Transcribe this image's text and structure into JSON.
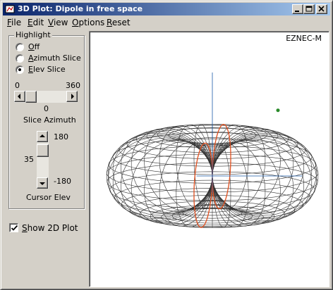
{
  "window": {
    "title": "3D Plot: Dipole in free space",
    "minimize_icon": "minimize-icon",
    "maximize_icon": "maximize-icon",
    "close_icon": "close-icon"
  },
  "menu": {
    "items": [
      {
        "prefix": "",
        "key": "F",
        "rest": "ile"
      },
      {
        "prefix": "",
        "key": "E",
        "rest": "dit"
      },
      {
        "prefix": "",
        "key": "V",
        "rest": "iew"
      },
      {
        "prefix": "",
        "key": "O",
        "rest": "ptions"
      },
      {
        "prefix": "",
        "key": "R",
        "rest": "eset"
      }
    ]
  },
  "highlight": {
    "title": "Highlight",
    "options": [
      {
        "prefix": "",
        "key": "O",
        "rest": "ff",
        "selected": false
      },
      {
        "prefix": "",
        "key": "A",
        "rest": "zimuth Slice",
        "selected": false
      },
      {
        "prefix": "",
        "key": "E",
        "rest": "lev Slice",
        "selected": true
      }
    ]
  },
  "slice_azimuth": {
    "min_label": "0",
    "max_label": "360",
    "value": "0",
    "label": "Slice Azimuth"
  },
  "cursor_elev": {
    "max_label": "180",
    "min_label": "-180",
    "value": "35",
    "label": "Cursor Elev"
  },
  "show_2d": {
    "prefix": "",
    "key": "S",
    "rest": "how 2D Plot",
    "checked": true
  },
  "plot": {
    "label": "EZNEC-M",
    "pattern": "dipole-3d-pattern",
    "colors": {
      "mesh": "#333333",
      "slice": "#e05020",
      "axis": "#1a5aa8",
      "cursor": "#2a8a2a"
    }
  }
}
